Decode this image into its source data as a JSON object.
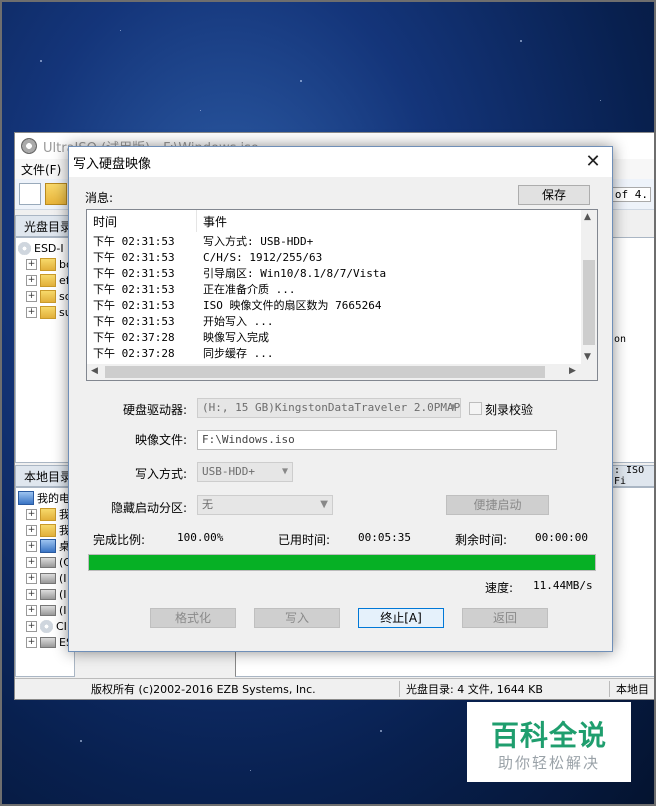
{
  "app": {
    "title": "UltraISO (试用版) - F:\\Windows.iso",
    "menu_file": "文件(F)",
    "cd_dir_header": "光盘目录",
    "local_dir_header": "本地目录",
    "tree_root": "ESD-I",
    "tree_items": [
      "bo",
      "ef",
      "so",
      "su"
    ],
    "local_tree_root": "我的电",
    "local_items": [
      "我",
      "我",
      "桌",
      "(C",
      "(I",
      "(I",
      "(I",
      "CI",
      "ES"
    ],
    "right_partial_1": "5% of 4.",
    "right_partial_2": "on",
    "right_partial_3": ": ISO Fi",
    "status_copyright": "版权所有 (c)2002-2016 EZB Systems, Inc.",
    "status_cd": "光盘目录: 4 文件, 1644 KB",
    "status_local": "本地目"
  },
  "dialog": {
    "title": "写入硬盘映像",
    "close_label": "✕",
    "messages_label": "消息:",
    "save_button": "保存",
    "log": {
      "col_time": "时间",
      "col_event": "事件",
      "rows": [
        {
          "time": "下午 02:31:53",
          "event": "写入方式: USB-HDD+"
        },
        {
          "time": "下午 02:31:53",
          "event": "C/H/S: 1912/255/63"
        },
        {
          "time": "下午 02:31:53",
          "event": "引导扇区: Win10/8.1/8/7/Vista"
        },
        {
          "time": "下午 02:31:53",
          "event": "正在准备介质 ..."
        },
        {
          "time": "下午 02:31:53",
          "event": "ISO 映像文件的扇区数为 7665264"
        },
        {
          "time": "下午 02:31:53",
          "event": "开始写入 ..."
        },
        {
          "time": "下午 02:37:28",
          "event": "映像写入完成"
        },
        {
          "time": "下午 02:37:28",
          "event": "同步缓存 ..."
        }
      ]
    },
    "drive_label": "硬盘驱动器:",
    "drive_value": "(H:, 15 GB)KingstonDataTraveler 2.0PMAP",
    "verify_label": "刻录校验",
    "image_label": "映像文件:",
    "image_value": "F:\\Windows.iso",
    "write_mode_label": "写入方式:",
    "write_mode_value": "USB-HDD+",
    "hidden_partition_label": "隐藏启动分区:",
    "hidden_partition_value": "无",
    "quick_boot_button": "便捷启动",
    "complete_ratio_label": "完成比例:",
    "complete_ratio_value": "100.00%",
    "elapsed_label": "已用时间:",
    "elapsed_value": "00:05:35",
    "remaining_label": "剩余时间:",
    "remaining_value": "00:00:00",
    "progress_fraction": 1.0,
    "speed_label": "速度:",
    "speed_value": "11.44MB/s",
    "format_button": "格式化",
    "write_button": "写入",
    "abort_button": "终止[A]",
    "back_button": "返回"
  },
  "watermark": {
    "title": "百科全说",
    "subtitle": "助你轻松解决"
  },
  "colors": {
    "progress_green": "#06b025",
    "watermark_green": "#1f9e6e"
  }
}
